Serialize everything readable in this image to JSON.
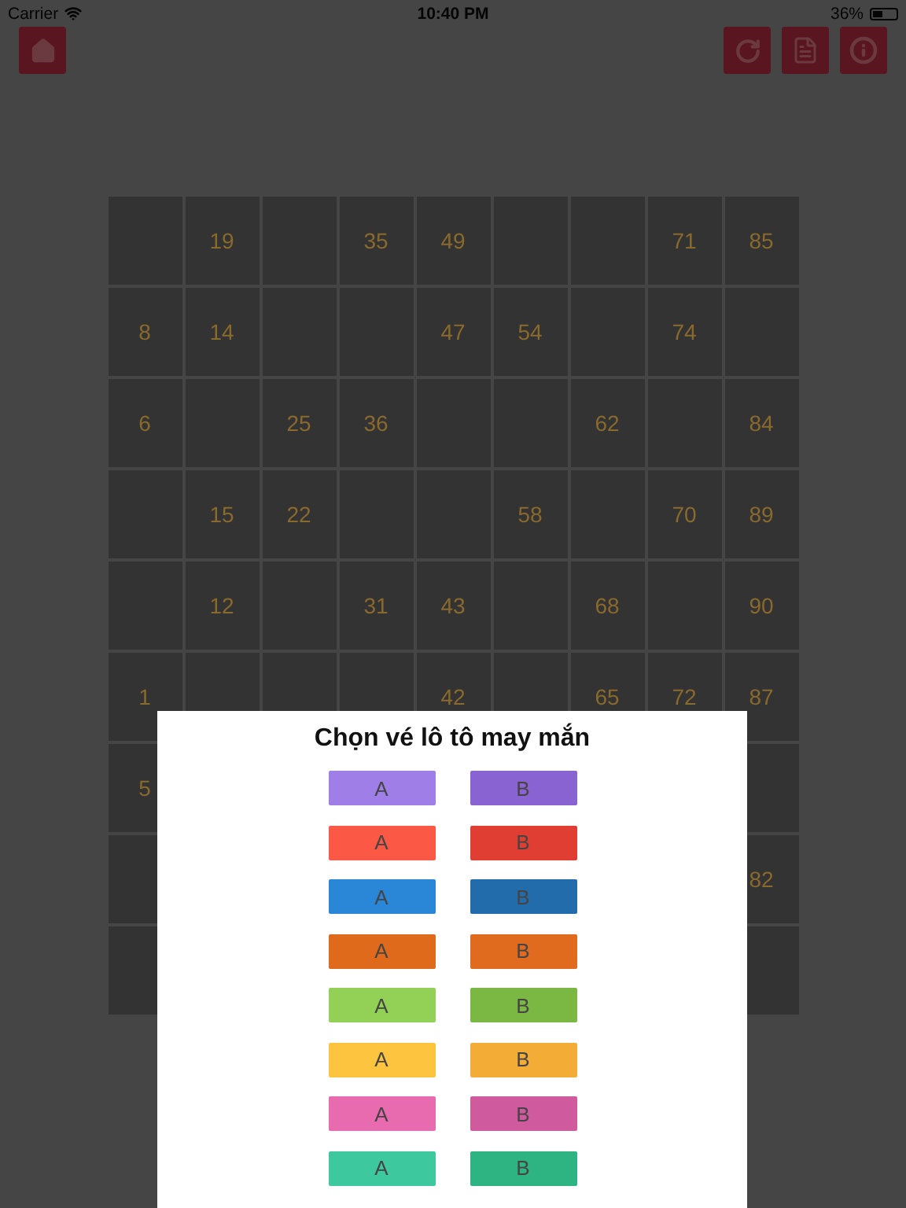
{
  "status_bar": {
    "carrier": "Carrier",
    "time": "10:40 PM",
    "battery": "36%"
  },
  "board": {
    "rows": [
      [
        {},
        {
          "number": "19"
        },
        {},
        {
          "number": "35"
        },
        {
          "number": "49"
        },
        {},
        {},
        {
          "number": "71"
        },
        {
          "number": "85"
        }
      ],
      [
        {
          "number": "8"
        },
        {
          "number": "14"
        },
        {},
        {},
        {
          "number": "47"
        },
        {
          "number": "54"
        },
        {},
        {
          "number": "74"
        },
        {}
      ],
      [
        {
          "number": "6"
        },
        {},
        {
          "number": "25"
        },
        {
          "number": "36"
        },
        {},
        {},
        {
          "number": "62"
        },
        {},
        {
          "number": "84"
        }
      ],
      [
        {},
        {
          "number": "15"
        },
        {
          "number": "22"
        },
        {},
        {},
        {
          "number": "58"
        },
        {},
        {
          "number": "70"
        },
        {
          "number": "89"
        }
      ],
      [
        {},
        {
          "number": "12"
        },
        {},
        {
          "number": "31"
        },
        {
          "number": "43"
        },
        {},
        {
          "number": "68"
        },
        {},
        {
          "number": "90"
        }
      ],
      [
        {
          "number": "1"
        },
        {},
        {},
        {},
        {
          "number": "42"
        },
        {},
        {
          "number": "65"
        },
        {
          "number": "72"
        },
        {
          "number": "87"
        }
      ],
      [
        {
          "number": "5"
        },
        null,
        null,
        null,
        null,
        null,
        null,
        null,
        {}
      ],
      [
        {},
        null,
        null,
        null,
        null,
        null,
        null,
        null,
        {
          "number": "82"
        }
      ],
      [
        {},
        null,
        null,
        null,
        null,
        null,
        null,
        null,
        {}
      ]
    ]
  },
  "dialog": {
    "title": "Chọn vé lô tô may mắn",
    "rows": [
      [
        {
          "label": "A",
          "color": "#a07ee8"
        },
        {
          "label": "B",
          "color": "#8a63d2"
        }
      ],
      [
        {
          "label": "A",
          "color": "#fc5846"
        },
        {
          "label": "B",
          "color": "#e03e32"
        }
      ],
      [
        {
          "label": "A",
          "color": "#2a86d6"
        },
        {
          "label": "B",
          "color": "#226cab"
        }
      ],
      [
        {
          "label": "A",
          "color": "#e06a1c"
        },
        {
          "label": "B",
          "color": "#e06a1d"
        }
      ],
      [
        {
          "label": "A",
          "color": "#93d056"
        },
        {
          "label": "B",
          "color": "#7ab843"
        }
      ],
      [
        {
          "label": "A",
          "color": "#fdc440"
        },
        {
          "label": "B",
          "color": "#f3ac36"
        }
      ],
      [
        {
          "label": "A",
          "color": "#e86bb0"
        },
        {
          "label": "B",
          "color": "#d05a9e"
        }
      ],
      [
        {
          "label": "A",
          "color": "#3ec89e"
        },
        {
          "label": "B",
          "color": "#2db482"
        }
      ]
    ]
  }
}
